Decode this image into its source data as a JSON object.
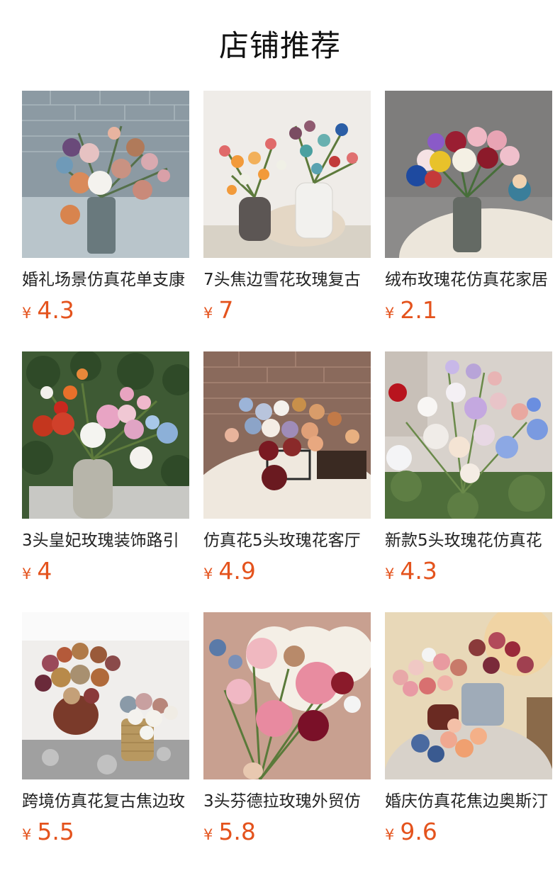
{
  "header": {
    "title": "店铺推荐"
  },
  "products": [
    {
      "name": "婚礼场景仿真花单支康",
      "currency": "¥",
      "price": "4.3",
      "image_icon": "flower-bouquet-photo"
    },
    {
      "name": "7头焦边雪花玫瑰复古",
      "currency": "¥",
      "price": "7",
      "image_icon": "flower-bouquet-photo"
    },
    {
      "name": "绒布玫瑰花仿真花家居",
      "currency": "¥",
      "price": "2.1",
      "image_icon": "flower-bouquet-photo"
    },
    {
      "name": "3头皇妃玫瑰装饰路引",
      "currency": "¥",
      "price": "4",
      "image_icon": "flower-bouquet-photo"
    },
    {
      "name": "仿真花5头玫瑰花客厅",
      "currency": "¥",
      "price": "4.9",
      "image_icon": "flower-bouquet-photo"
    },
    {
      "name": "新款5头玫瑰花仿真花",
      "currency": "¥",
      "price": "4.3",
      "image_icon": "flower-bouquet-photo"
    },
    {
      "name": "跨境仿真花复古焦边玫",
      "currency": "¥",
      "price": "5.5",
      "image_icon": "flower-bouquet-photo"
    },
    {
      "name": "3头芬德拉玫瑰外贸仿",
      "currency": "¥",
      "price": "5.8",
      "image_icon": "flower-bouquet-photo"
    },
    {
      "name": "婚庆仿真花焦边奥斯汀",
      "currency": "¥",
      "price": "9.6",
      "image_icon": "flower-bouquet-photo"
    }
  ],
  "colors": {
    "price": "#e4531d",
    "title": "#111111",
    "text": "#222222"
  }
}
